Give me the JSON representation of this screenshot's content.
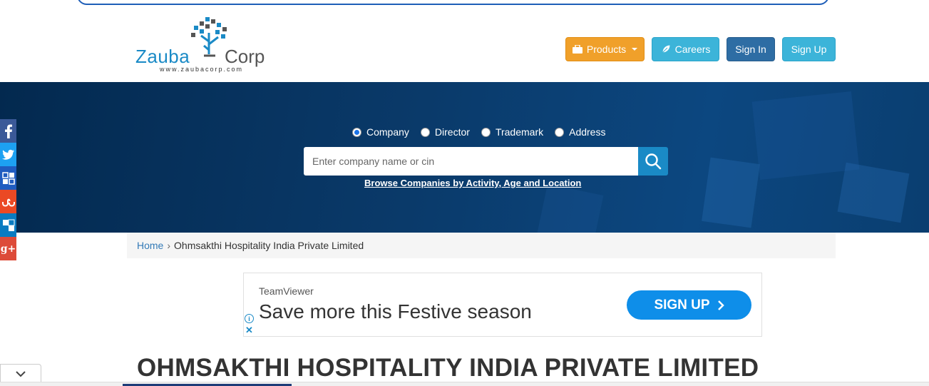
{
  "header": {
    "logo": {
      "left_word": "Zauba",
      "right_word": "Corp",
      "url": "www.zaubacorp.com"
    },
    "nav": {
      "products_label": "Products",
      "careers_label": "Careers",
      "signin_label": "Sign In",
      "signup_label": "Sign Up"
    }
  },
  "hero": {
    "search_types": [
      {
        "label": "Company",
        "checked": true
      },
      {
        "label": "Director",
        "checked": false
      },
      {
        "label": "Trademark",
        "checked": false
      },
      {
        "label": "Address",
        "checked": false
      }
    ],
    "search": {
      "placeholder": "Enter company name or cin",
      "value": ""
    },
    "browse_link": "Browse Companies by Activity, Age and Location"
  },
  "social": {
    "items": [
      {
        "name": "facebook",
        "glyph": "f",
        "color": "#3b5998"
      },
      {
        "name": "twitter",
        "glyph": "t",
        "color": "#1da1f2"
      },
      {
        "name": "delicious",
        "glyph": "d",
        "color": "#205cc0"
      },
      {
        "name": "stumbleupon",
        "glyph": "su",
        "color": "#eb4924"
      },
      {
        "name": "share",
        "glyph": "s",
        "color": "#0a7bc1"
      },
      {
        "name": "googleplus",
        "glyph": "g+",
        "color": "#dd4b39"
      }
    ]
  },
  "breadcrumb": {
    "home": "Home",
    "separator": "›",
    "current": "Ohmsakthi Hospitality India Private Limited"
  },
  "ad": {
    "brand": "TeamViewer",
    "headline": "Save more this Festive season",
    "cta": "SIGN UP",
    "info": "i",
    "close": "✕"
  },
  "company": {
    "title": "OHMSAKTHI HOSPITALITY INDIA PRIVATE LIMITED"
  },
  "colors": {
    "primary": "#1a8ac6",
    "products": "#f0a02a",
    "signin": "#2e6da4",
    "hero": "#03294f"
  }
}
